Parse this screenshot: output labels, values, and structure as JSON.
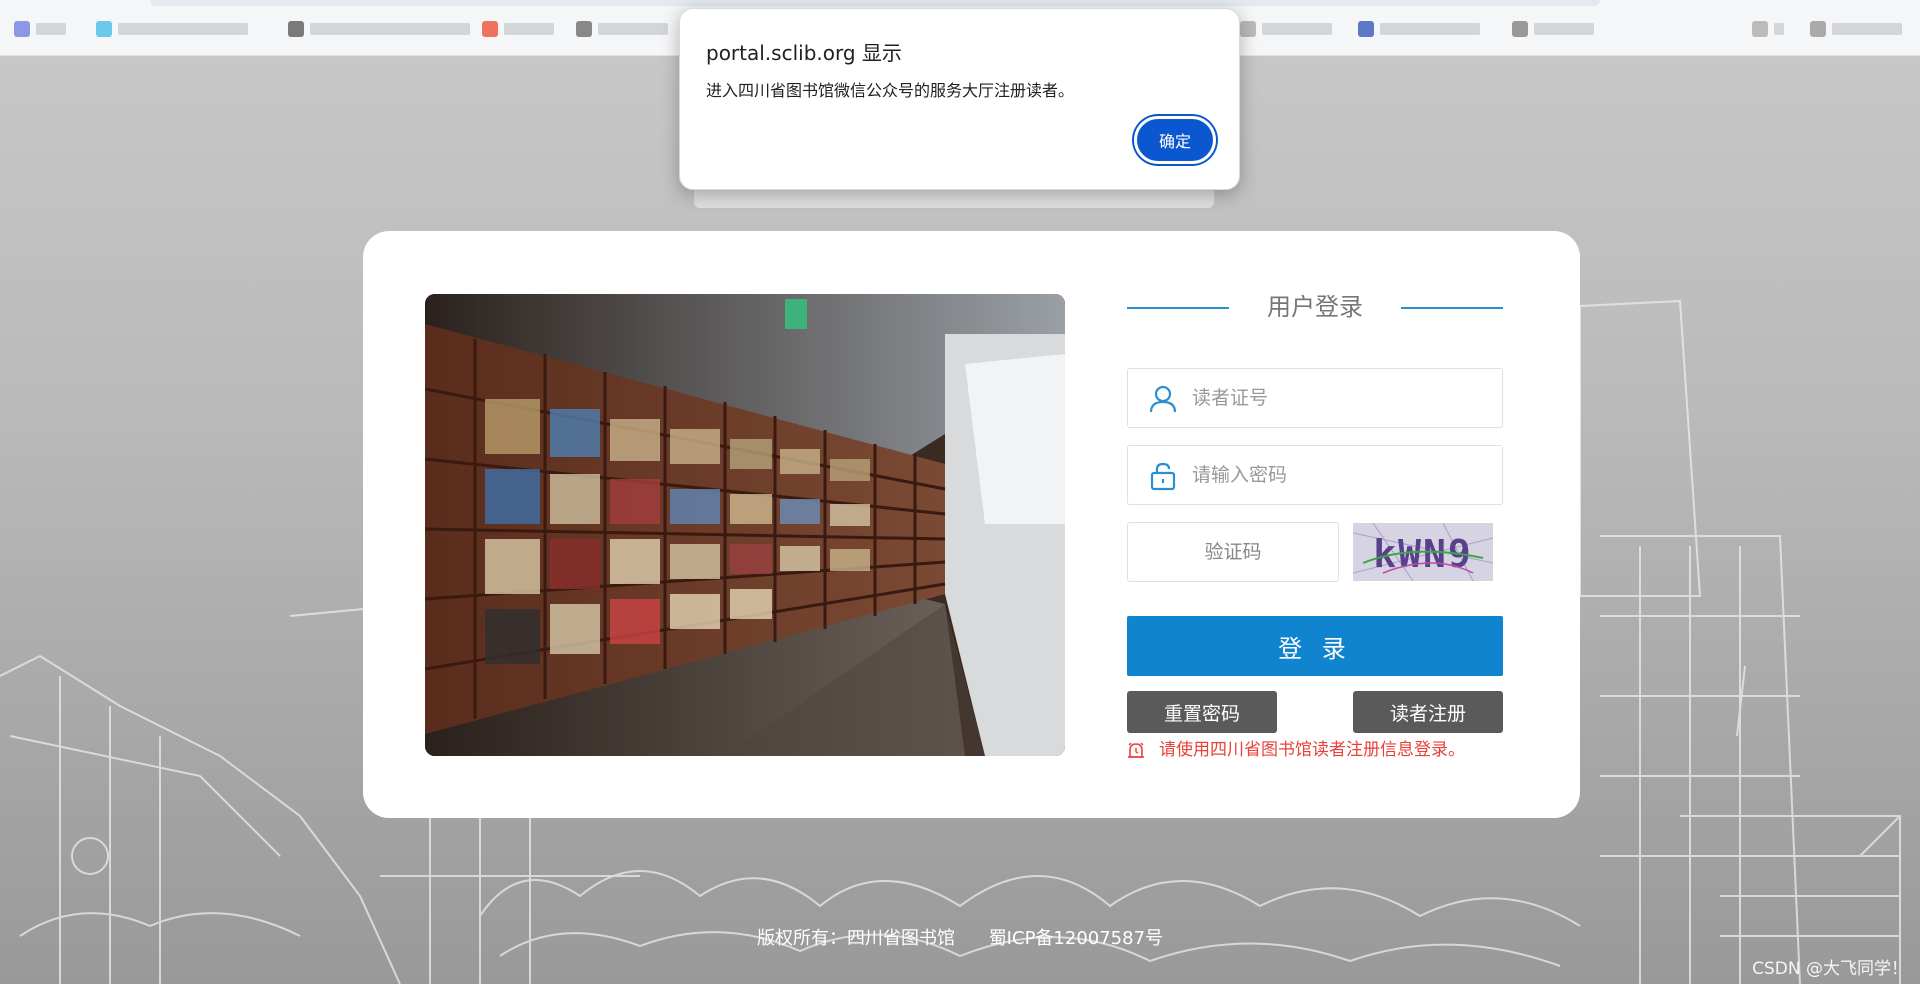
{
  "dialog": {
    "origin": "portal.sclib.org 显示",
    "message": "进入四川省图书馆微信公众号的服务大厅注册读者。",
    "ok_label": "确定"
  },
  "login": {
    "title": "用户登录",
    "card_placeholder": "读者证号",
    "password_placeholder": "请输入密码",
    "captcha_placeholder": "验证码",
    "captcha_text": "kWN9",
    "login_label": "登 录",
    "reset_label": "重置密码",
    "register_label": "读者注册",
    "notice": "请使用四川省图书馆读者注册信息登录。"
  },
  "footer": {
    "copyright": "版权所有：四川省图书馆",
    "icp": "蜀ICP备12007587号"
  },
  "watermark": "CSDN @大飞同学！",
  "colors": {
    "primary": "#1184d0",
    "dialog_button": "#0b57d0",
    "notice": "#e8423a",
    "secondary_button": "#5a5a5a"
  },
  "icons": {
    "card_field": "user-icon",
    "password_field": "lock-icon",
    "notice": "alarm-icon"
  }
}
